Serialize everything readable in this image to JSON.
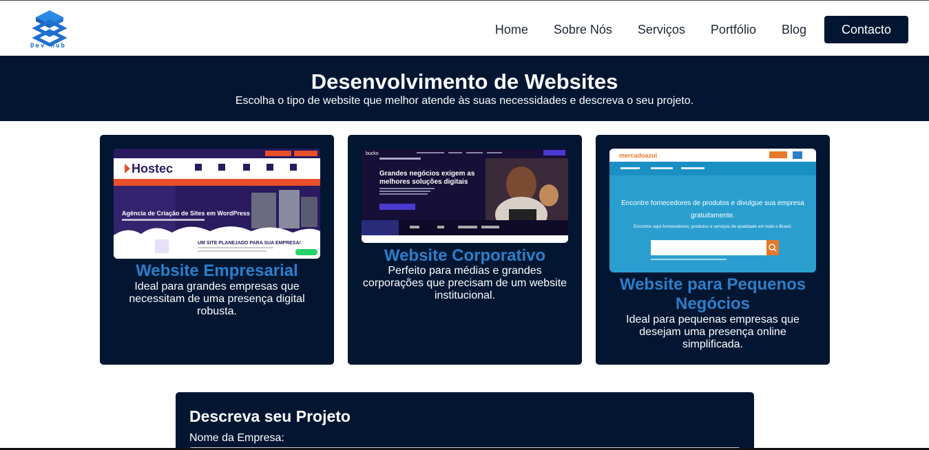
{
  "brand": {
    "name": "Dev Hub"
  },
  "nav": {
    "items": [
      "Home",
      "Sobre Nós",
      "Serviços",
      "Portfólio",
      "Blog"
    ],
    "contact_label": "Contacto"
  },
  "hero": {
    "title": "Desenvolvimento de Websites",
    "subtitle": "Escolha o tipo de website que melhor atende às suas necessidades e descreva o seu projeto."
  },
  "cards": [
    {
      "title": "Website Empresarial",
      "description": "Ideal para grandes empresas que necessitam de uma presença digital robusta.",
      "preview": {
        "logo": "Hostec",
        "headline": "Agência de Criação de Sites em WordPress",
        "tagline": "UM SITE PLANEJADO PARA SUA EMPRESA!"
      }
    },
    {
      "title": "Website Corporativo",
      "description": "Perfeito para médias e grandes corporações que precisam de um website institucional.",
      "preview": {
        "logo": "bucko",
        "headline_line1": "Grandes negócios exigem as",
        "headline_line2": "melhores soluções digitais"
      }
    },
    {
      "title": "Website para Pequenos Negócios",
      "description": "Ideal para pequenas empresas que desejam uma presença online simplificada.",
      "preview": {
        "logo": "mercadoazul",
        "headline_line1": "Encontre fornecedores de produtos e divulgue sua empresa",
        "headline_line2": "gratuitamente.",
        "subline": "Encontre aqui fornecedores, produtos e serviços de qualidade em todo o Brasil."
      }
    }
  ],
  "form": {
    "title": "Descreva seu Projeto",
    "company_label": "Nome da Empresa:",
    "company_value": ""
  },
  "colors": {
    "navy": "#021632",
    "accent": "#2d7fc9"
  }
}
